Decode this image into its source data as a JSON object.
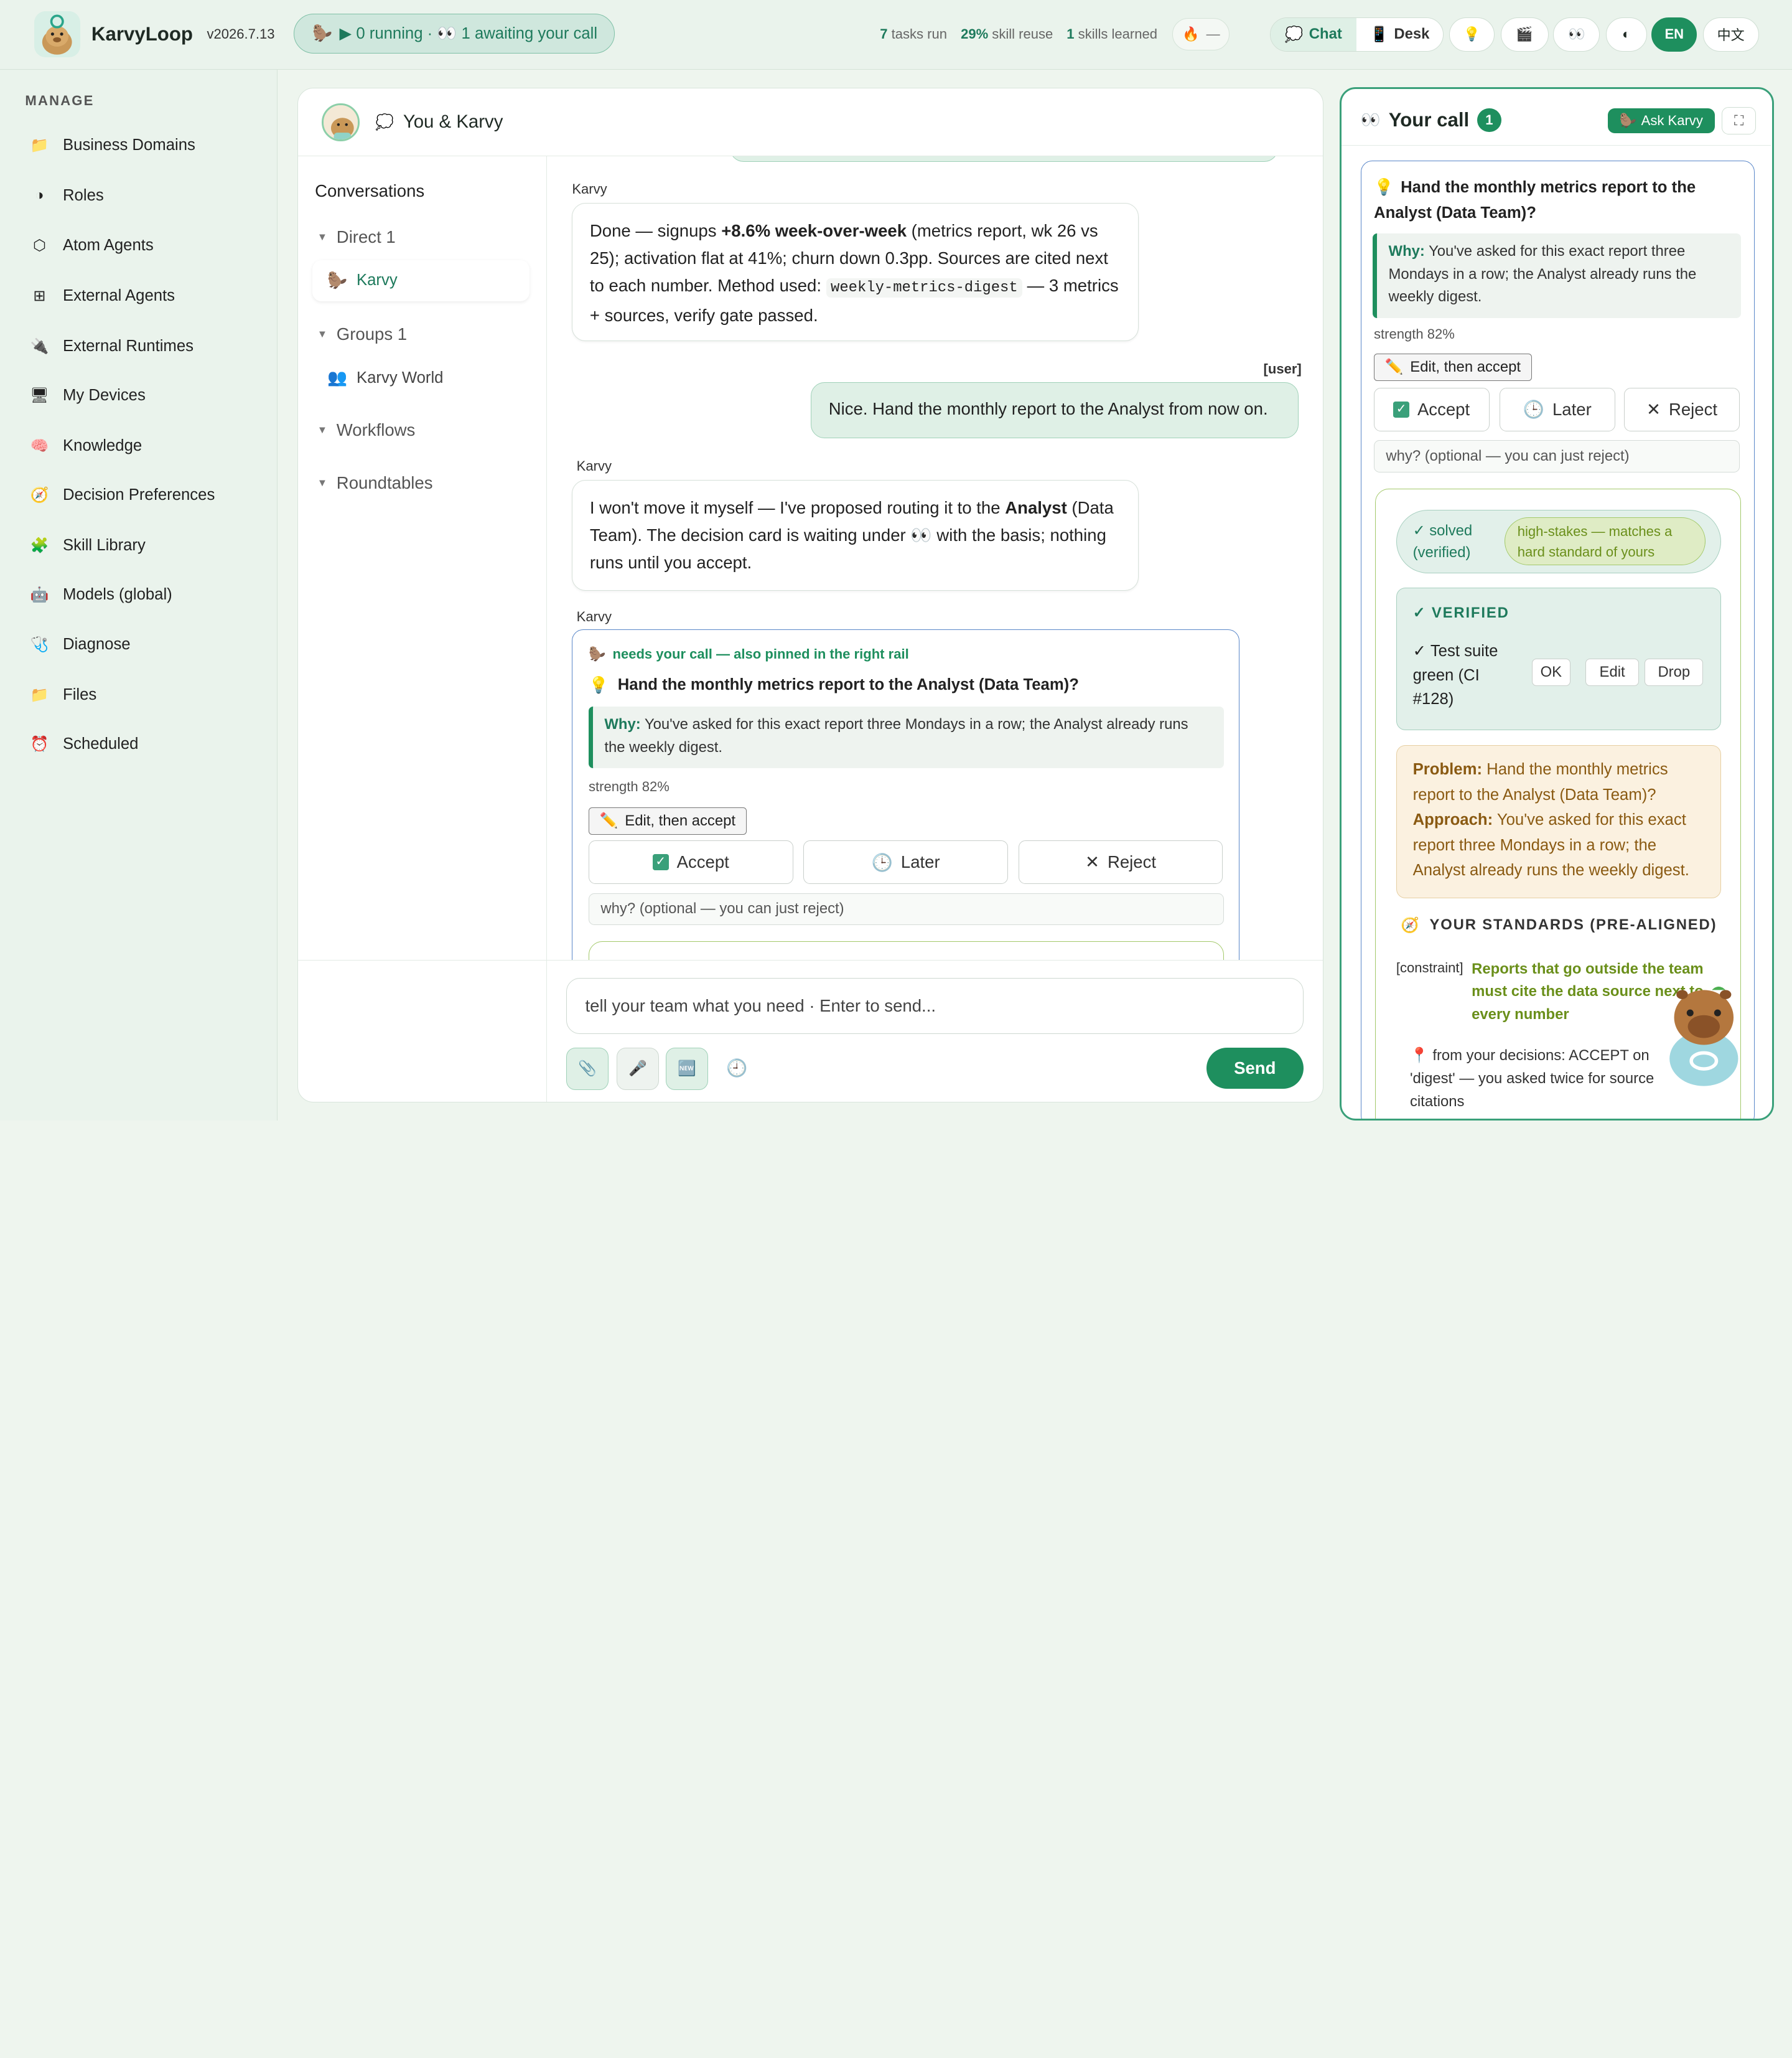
{
  "header": {
    "brand": "KarvyLoop",
    "version": "v2026.7.13",
    "status": "▶ 0 running · 👀 1 awaiting your call",
    "stats": {
      "tasks_run_value": "7",
      "tasks_run_label": "tasks run",
      "skill_reuse_value": "29%",
      "skill_reuse_label": "skill reuse",
      "skills_learned_value": "1",
      "skills_learned_label": "skills learned"
    },
    "ember": "—",
    "modes": {
      "chat": "Chat",
      "desk": "Desk"
    },
    "lang_en": "EN",
    "lang_zh": "中文"
  },
  "sidebar": {
    "section": "MANAGE",
    "items": [
      {
        "label": "Business Domains",
        "icon": "folder-icon"
      },
      {
        "label": "Roles",
        "icon": "contrast-icon"
      },
      {
        "label": "Atom Agents",
        "icon": "hexagon-icon"
      },
      {
        "label": "External Agents",
        "icon": "grid-icon"
      },
      {
        "label": "External Runtimes",
        "icon": "plug-icon"
      },
      {
        "label": "My Devices",
        "icon": "monitor-icon"
      },
      {
        "label": "Knowledge",
        "icon": "brain-icon"
      },
      {
        "label": "Decision Preferences",
        "icon": "compass-icon"
      },
      {
        "label": "Skill Library",
        "icon": "puzzle-icon"
      },
      {
        "label": "Models (global)",
        "icon": "robot-icon"
      },
      {
        "label": "Diagnose",
        "icon": "stethoscope-icon"
      },
      {
        "label": "Files",
        "icon": "folder-icon"
      },
      {
        "label": "Scheduled",
        "icon": "alarm-icon"
      }
    ]
  },
  "chat": {
    "title": "You & Karvy",
    "conversations_label": "Conversations",
    "groups": [
      {
        "label": "Direct 1"
      },
      {
        "label": "Groups 1"
      },
      {
        "label": "Workflows"
      },
      {
        "label": "Roundtables"
      }
    ],
    "direct_item": "Karvy",
    "group_item": "Karvy World",
    "messages": [
      {
        "sender": "Karvy",
        "p1": "Done — signups ",
        "bold": "+8.6% week-over-week",
        "p2": " (metrics report, wk 26 vs 25); activation flat at 41%; churn down 0.3pp. Sources are cited next to each number. Method used: ",
        "code": "weekly-metrics-digest",
        "p3": " — 3 metrics + sources, verify gate passed."
      },
      {
        "sender": "[user]",
        "text": "Nice. Hand the monthly report to the Analyst from now on."
      },
      {
        "sender": "Karvy",
        "p1": "I won't move it myself — I've proposed routing it to the ",
        "bold": "Analyst",
        "p2": " (Data Team). The decision card is waiting under 👀 with the basis; nothing runs until you accept."
      },
      {
        "sender": "Karvy"
      }
    ],
    "card": {
      "tag": "needs your call — also pinned in the right rail",
      "question": "Hand the monthly metrics report to the Analyst (Data Team)?",
      "why_label": "Why:",
      "why": "You've asked for this exact report three Mondays in a row; the Analyst already runs the weekly digest.",
      "strength": "strength 82%",
      "edit": "Edit, then accept",
      "accept": "Accept",
      "later": "Later",
      "reject": "Reject",
      "why_placeholder": "why? (optional — you can just reject)"
    },
    "composer": {
      "placeholder": "tell your team what you need · Enter to send...",
      "send": "Send"
    }
  },
  "rail": {
    "title": "Your call",
    "count": "1",
    "ask": "Ask Karvy",
    "question": "Hand the monthly metrics report to the Analyst (Data Team)?",
    "why_label": "Why:",
    "why": "You've asked for this exact report three Mondays in a row; the Analyst already runs the weekly digest.",
    "strength": "strength 82%",
    "edit": "Edit, then accept",
    "accept": "Accept",
    "later": "Later",
    "reject": "Reject",
    "why_placeholder": "why? (optional — you can just reject)",
    "solved": "✓ solved (verified)",
    "high_stakes": "high-stakes — matches a hard standard of yours",
    "verified_label": "✓ VERIFIED",
    "verified_item": "✓ Test suite green (CI #128)",
    "ok": "OK",
    "edit_small": "Edit",
    "drop": "Drop",
    "problem_label": "Problem:",
    "problem": "Hand the monthly metrics report to the Analyst (Data Team)?",
    "approach_label": "Approach:",
    "approach": "You've asked for this exact report three Mondays in a row; the Analyst already runs the weekly digest.",
    "standards_label": "YOUR STANDARDS (PRE-ALIGNED)",
    "constraint_tag": "[constraint]",
    "constraint_text": "Reports that go outside the team must cite the data source next to every number",
    "from_decisions": "from your decisions: ACCEPT on 'digest' — you asked twice for source citations"
  },
  "colors": {
    "accent": "#1e8f5e",
    "accent_light": "#dff0e6",
    "card_border": "#5a87c9",
    "olive": "#6a8f1a",
    "amber_bg": "#fbf1e0"
  }
}
